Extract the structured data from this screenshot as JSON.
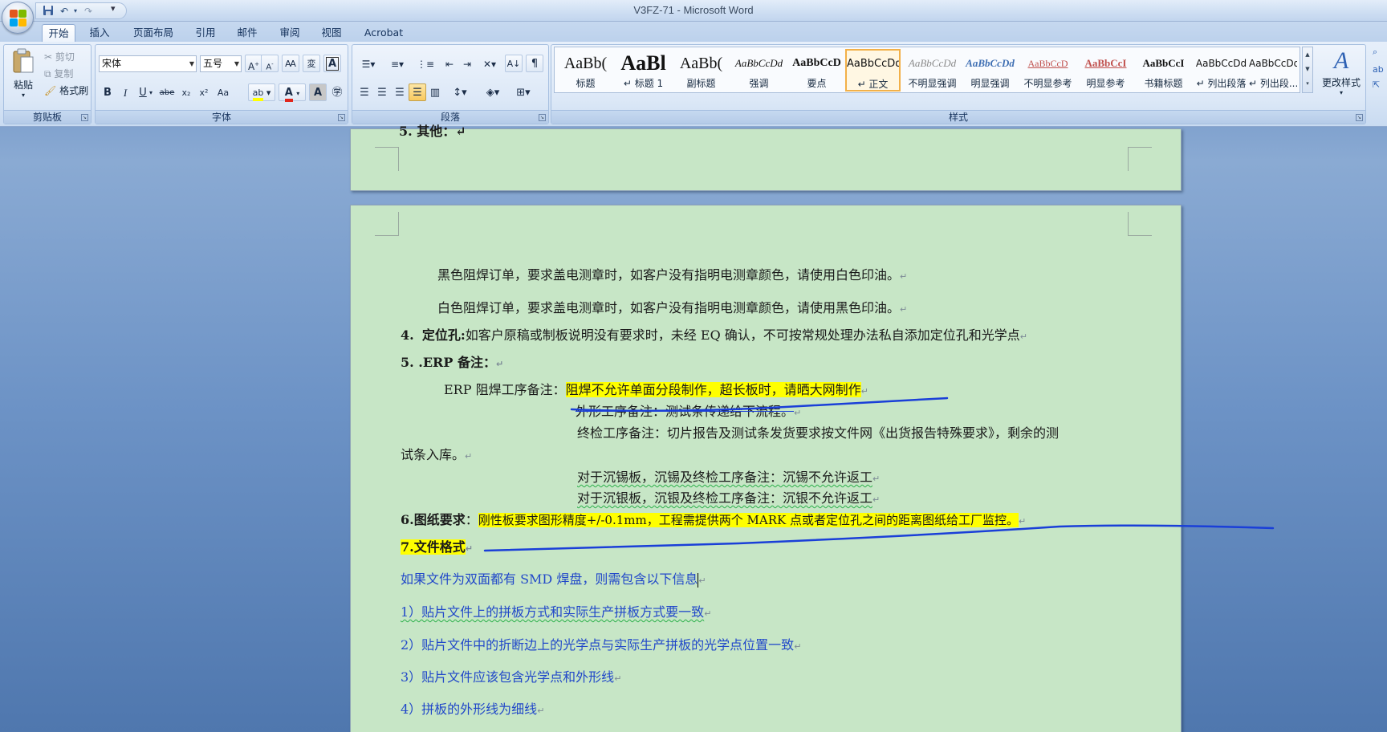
{
  "window": {
    "title": "V3FZ-71 - Microsoft Word"
  },
  "tabs": [
    {
      "label": "开始",
      "active": true
    },
    {
      "label": "插入"
    },
    {
      "label": "页面布局"
    },
    {
      "label": "引用"
    },
    {
      "label": "邮件"
    },
    {
      "label": "审阅"
    },
    {
      "label": "视图"
    },
    {
      "label": "Acrobat"
    }
  ],
  "clipboard": {
    "group_label": "剪贴板",
    "paste": "粘贴",
    "cut": "剪切",
    "copy": "复制",
    "format_painter": "格式刷"
  },
  "font": {
    "group_label": "字体",
    "name": "宋体",
    "size": "五号",
    "buttons": [
      "B",
      "I",
      "U",
      "abe",
      "x₂",
      "x²",
      "Aa"
    ]
  },
  "paragraph": {
    "group_label": "段落"
  },
  "styles": {
    "group_label": "样式",
    "change_styles": "更改样式",
    "items": [
      {
        "preview": "AaBb(",
        "label": "标题"
      },
      {
        "preview": "AaBl",
        "label": "↵ 标题 1"
      },
      {
        "preview": "AaBb(",
        "label": "副标题"
      },
      {
        "preview": "AaBbCcDd",
        "label": "强调"
      },
      {
        "preview": "AaBbCcD",
        "label": "要点"
      },
      {
        "preview": "AaBbCcDd",
        "label": "↵ 正文",
        "selected": true
      },
      {
        "preview": "AaBbCcDd",
        "label": "不明显强调"
      },
      {
        "preview": "AaBbCcDd",
        "label": "明显强调"
      },
      {
        "preview": "AaBbCcD",
        "label": "不明显参考"
      },
      {
        "preview": "AaBbCcI",
        "label": "明显参考"
      },
      {
        "preview": "AaBbCcI",
        "label": "书籍标题"
      },
      {
        "preview": "AaBbCcDd",
        "label": "↵ 列出段落"
      },
      {
        "preview": "AaBbCcDd",
        "label": "↵ 列出段..."
      }
    ]
  },
  "document": {
    "top_page_fragment": "5.  其他：↵",
    "lines": {
      "l1": "黑色阻焊订单，要求盖电测章时，如客户没有指明电测章颜色，请使用白色印油。",
      "l2": "白色阻焊订单，要求盖电测章时，如客户没有指明电测章颜色，请使用黑色印油。",
      "l3_num": "4.",
      "l3_bold": "定位孔:",
      "l3_text": "如客户原稿或制板说明没有要求时，未经 EQ 确认，不可按常规处理办法私自添加定位孔和光学点",
      "l4": "5. .ERP 备注：",
      "l5_prefix": "ERP 阻焊工序备注：",
      "l5_hl": "阻焊不允许单面分段制作，超长板时，请晒大网制作",
      "l6": "外形工序备注：测试条传递给下流程。",
      "l7": "终检工序备注：切片报告及测试条发货要求按文件网《出货报告特殊要求》，剩余的测",
      "l8": "试条入库。",
      "l9": "对于沉锡板，沉锡及终检工序备注：沉锡不允许返工",
      "l10": "对于沉银板，沉银及终检工序备注：沉银不允许返工",
      "l11_bold": "6.图纸要求",
      "l11_colon": "：",
      "l11_hl": "刚性板要求图形精度+/-0.1mm，工程需提供两个 MARK 点或者定位孔之间的距离图纸给工厂监控。",
      "l12": "7.文件格式",
      "l13": "如果文件为双面都有 SMD 焊盘，则需包含以下信息",
      "l14": "1）贴片文件上的拼板方式和实际生产拼板方式要一致",
      "l15": "2）贴片文件中的折断边上的光学点与实际生产拼板的光学点位置一致",
      "l16": "3）贴片文件应该包含光学点和外形线",
      "l17": "4）拼板的外形线为细线"
    },
    "para_mark": "↵"
  },
  "colors": {
    "page_bg": "#c7e6c6",
    "highlight": "#ffff00",
    "ink": "#1a3fd8",
    "blue_text": "#2148c9"
  }
}
